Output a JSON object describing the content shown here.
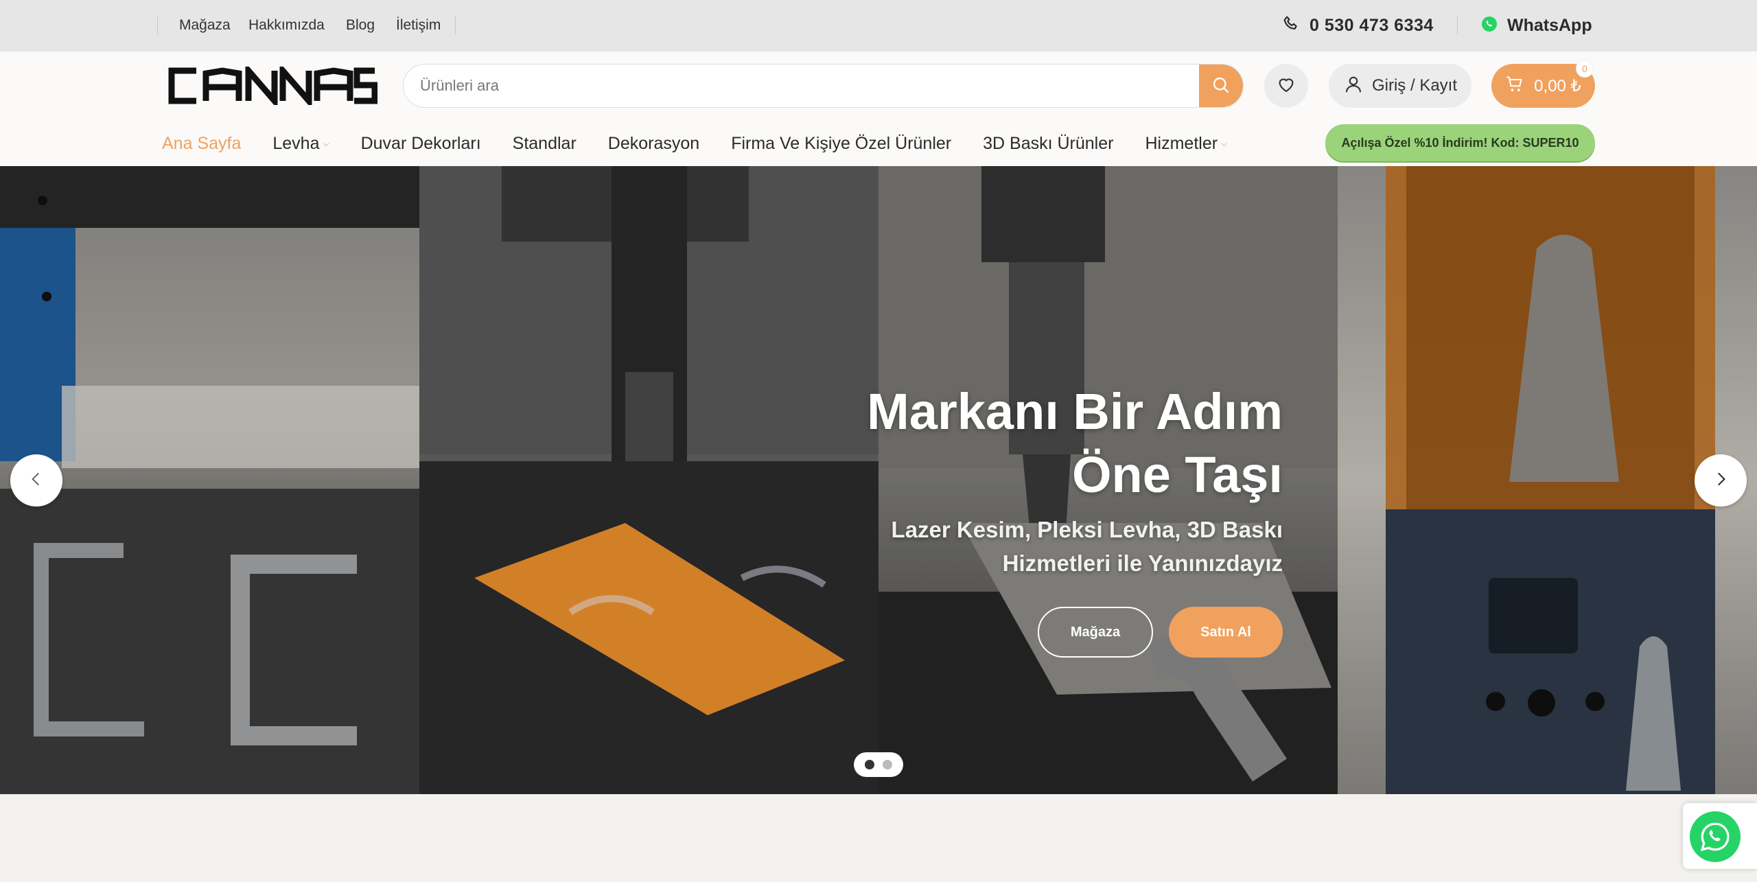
{
  "topbar": {
    "links": [
      "Mağaza",
      "Hakkımızda",
      "Blog",
      "İletişim"
    ],
    "phone": "0 530 473 6334",
    "whatsapp": "WhatsApp"
  },
  "header": {
    "logo_text": "CANNAS",
    "search_placeholder": "Ürünleri ara",
    "login_label": "Giriş / Kayıt",
    "cart_total": "0,00 ₺",
    "cart_count": "0"
  },
  "nav": {
    "items": [
      {
        "label": "Ana Sayfa"
      },
      {
        "label": "Levha"
      },
      {
        "label": "Duvar Dekorları"
      },
      {
        "label": "Standlar"
      },
      {
        "label": "Dekorasyon"
      },
      {
        "label": "Firma Ve Kişiye Özel Ürünler"
      },
      {
        "label": "3D Baskı Ürünler"
      },
      {
        "label": "Hizmetler"
      }
    ],
    "promo": "Açılışa Özel %10 İndirim! Kod: SUPER10"
  },
  "hero": {
    "title_line1": "Markanı Bir Adım",
    "title_line2": "Öne Taşı",
    "subtitle_line1": "Lazer Kesim, Pleksi Levha, 3D Baskı",
    "subtitle_line2": "Hizmetleri ile Yanınızdayız",
    "button_shop": "Mağaza",
    "button_buy": "Satın Al"
  },
  "colors": {
    "accent": "#f0a15e",
    "promo": "#9ad37a",
    "whatsapp": "#25d366"
  }
}
